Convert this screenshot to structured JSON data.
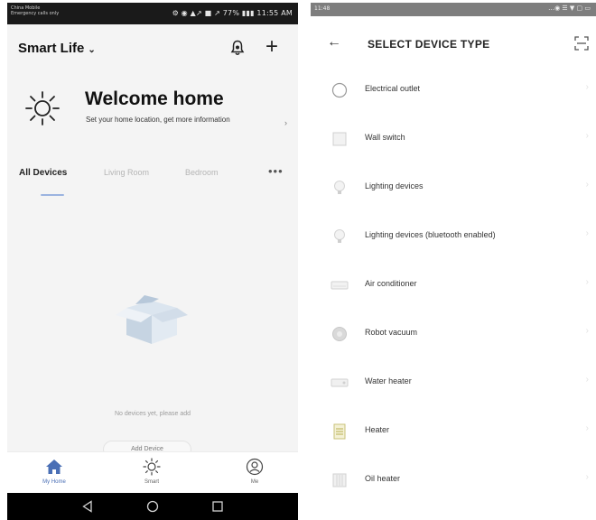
{
  "left_screen": {
    "status_bar": {
      "carrier_line1": "China Mobile",
      "carrier_line2": "Emergency calls only",
      "right": "⚙ ◉ ▲↗ ■ ↗ 77% ▮▮▮ 11:55 AM"
    },
    "header": {
      "home_name": "Smart Life",
      "home_chevron": "⌄",
      "add_symbol": "+"
    },
    "welcome": {
      "title": "Welcome home",
      "subtitle": "Set your home location, get more information",
      "arrow": "›"
    },
    "tabs": [
      {
        "label": "All Devices"
      },
      {
        "label": "Living Room"
      },
      {
        "label": "Bedroom"
      },
      {
        "label": "•••"
      }
    ],
    "empty_state": {
      "text": "No devices yet, please add",
      "button_label": "Add Device"
    },
    "bottom_nav": [
      {
        "label": "My Home",
        "icon": "home-icon"
      },
      {
        "label": "Smart",
        "icon": "sun-icon"
      },
      {
        "label": "Me",
        "icon": "user-icon"
      }
    ],
    "accent_color": "#4a6fb5"
  },
  "right_screen": {
    "status_bar": {
      "time": "11:48",
      "icons": "…◉ ☰ ▼ ▢ ▭"
    },
    "header": {
      "back": "←",
      "title": "SELECT DEVICE TYPE"
    },
    "device_types": [
      {
        "label": "Electrical outlet",
        "icon": "outlet-icon"
      },
      {
        "label": "Wall switch",
        "icon": "wall-switch-icon"
      },
      {
        "label": "Lighting devices",
        "icon": "bulb-icon"
      },
      {
        "label": "Lighting devices (bluetooth enabled)",
        "icon": "bulb-bluetooth-icon"
      },
      {
        "label": "Air conditioner",
        "icon": "air-conditioner-icon"
      },
      {
        "label": "Robot vacuum",
        "icon": "robot-vacuum-icon"
      },
      {
        "label": "Water heater",
        "icon": "water-heater-icon"
      },
      {
        "label": "Heater",
        "icon": "heater-icon"
      },
      {
        "label": "Oil heater",
        "icon": "oil-heater-icon"
      }
    ],
    "chevron": "›"
  }
}
